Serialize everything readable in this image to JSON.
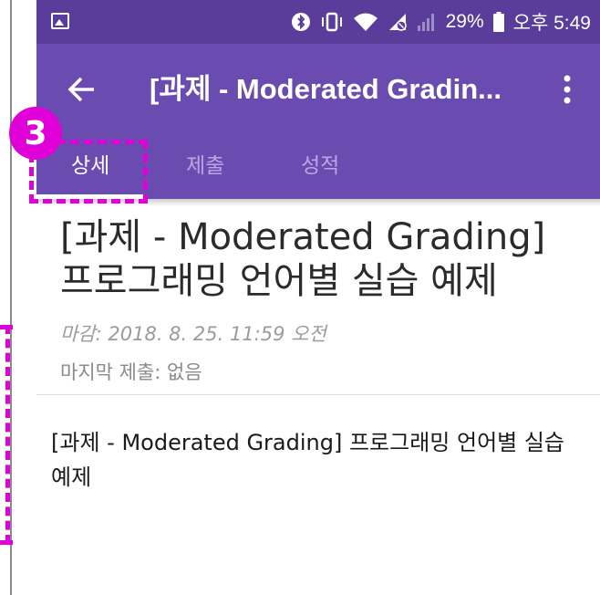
{
  "status_bar": {
    "battery_percent": "29%",
    "time": "오후 5:49",
    "icons": [
      "image-icon",
      "bluetooth-icon",
      "vibrate-icon",
      "wifi-icon",
      "no-data-icon",
      "signal-icon",
      "battery-icon"
    ]
  },
  "toolbar": {
    "title": "[과제 - Moderated Gradin..."
  },
  "tabs": [
    {
      "label": "상세",
      "active": true
    },
    {
      "label": "제출",
      "active": false
    },
    {
      "label": "성적",
      "active": false
    }
  ],
  "annotation": {
    "step_number": "3",
    "accent_color": "#e000d8"
  },
  "content": {
    "title": "[과제 - Moderated Grading] 프로그래밍 언어별 실습 예제",
    "due_label": "마감: 2018. 8. 25. 11:59 오전",
    "last_submission": "마지막 제출: 없음",
    "body": "[과제 - Moderated Grading] 프로그래밍 언어별 실습 예제"
  },
  "colors": {
    "status_bar": "#5a3d9a",
    "toolbar": "#6a4cb0",
    "tab_inactive": "#b9a6e2"
  }
}
